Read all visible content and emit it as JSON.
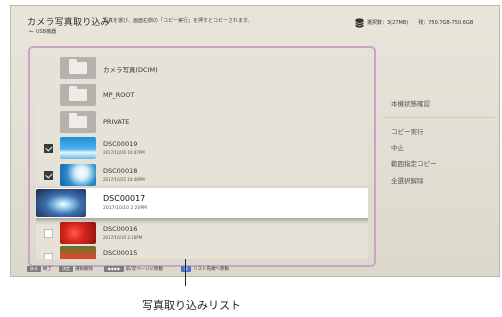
{
  "header": {
    "title": "カメラ写真取り込み",
    "description": "写真を選び、画面右側の「コピー実行」を押すとコピーされます。",
    "source": "USB機器",
    "selection_count": "選択数：3(27MB)",
    "remaining_space": "残：750.7GB-750.6GB"
  },
  "list": {
    "rows": [
      {
        "kind": "folder",
        "name": "カメラ写真(DCIM)",
        "date": "",
        "checked": false
      },
      {
        "kind": "folder",
        "name": "MP_ROOT",
        "date": "",
        "checked": false
      },
      {
        "kind": "folder",
        "name": "PRIVATE",
        "date": "",
        "checked": false
      },
      {
        "kind": "photo",
        "name": "DSC00019",
        "date": "2017/10/26  10:47PM",
        "checked": true
      },
      {
        "kind": "photo",
        "name": "DSC00018",
        "date": "2017/10/25  10:46PM",
        "checked": true
      },
      {
        "kind": "photo",
        "name": "DSC00017",
        "date": "2017/10/10    2:20PM",
        "checked": true,
        "focused": true
      },
      {
        "kind": "photo",
        "name": "DSC00016",
        "date": "2017/10/10    2:18PM",
        "checked": false
      },
      {
        "kind": "photo",
        "name": "DSC00015",
        "date": "",
        "checked": false
      }
    ]
  },
  "side_menu": {
    "storage_check": "本機状態確認",
    "copy_run": "コピー実行",
    "stop": "中止",
    "range_copy": "範囲指定コピー",
    "deselect_all": "全選択解除"
  },
  "footer": {
    "back_key": "戻る",
    "exit_label": "終了",
    "decide_key": "決定",
    "select_label": "選択解除",
    "page_keys": "◀◀  ▶▶",
    "page_label": "前/次ページに移動",
    "blue_key": "青",
    "blue_label": "リスト先頭へ移動"
  },
  "caption": "写真取り込みリスト",
  "colors": {
    "focus_frame": "#c7a4c9",
    "checkbox_checked": "#3a3a3a",
    "panel_bg": "#e6e2d7",
    "blue_key": "#4b6ed2"
  },
  "icons": {
    "storage": "database-icon",
    "usb": "usb-icon",
    "folder": "folder-icon",
    "checkbox": "checkbox-icon"
  }
}
